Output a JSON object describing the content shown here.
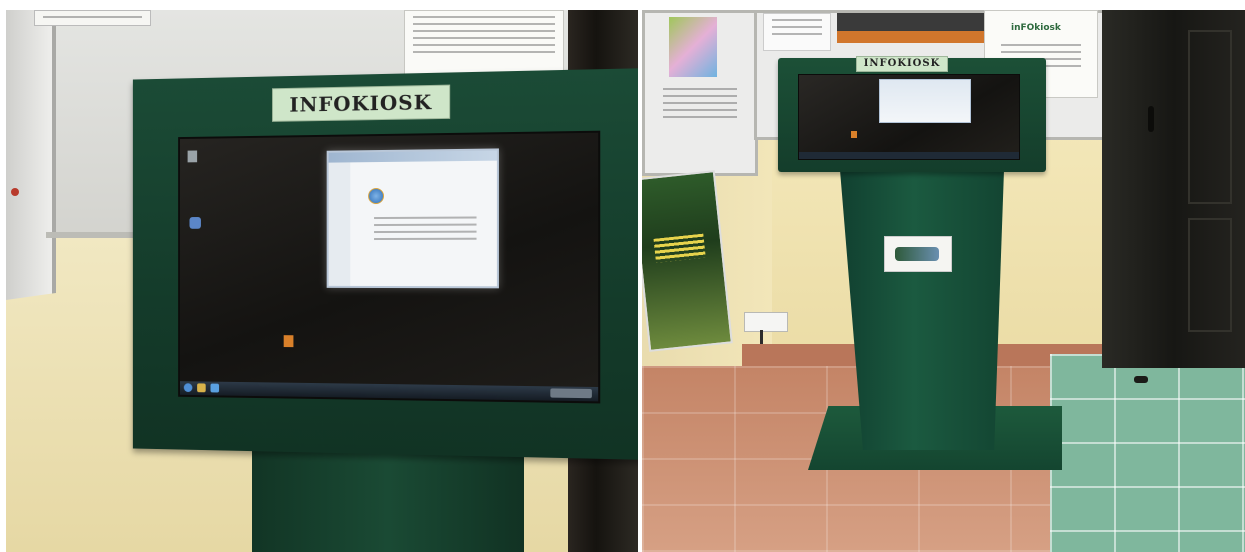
{
  "photos": [
    {
      "id": "left",
      "kiosk_label": "INFOKIOSK"
    },
    {
      "id": "right",
      "kiosk_label": "INFOKIOSK",
      "poster_logo": "inFOkiosk"
    }
  ],
  "colors": {
    "kiosk_green": "#16402e",
    "wall_lower": "#efe4b4",
    "wall_upper": "#dcdcd7",
    "floor_terracotta": "#c98a6c",
    "floor_green": "#7fb39a",
    "screen": "#1b1a18",
    "door": "#1c1c19"
  }
}
